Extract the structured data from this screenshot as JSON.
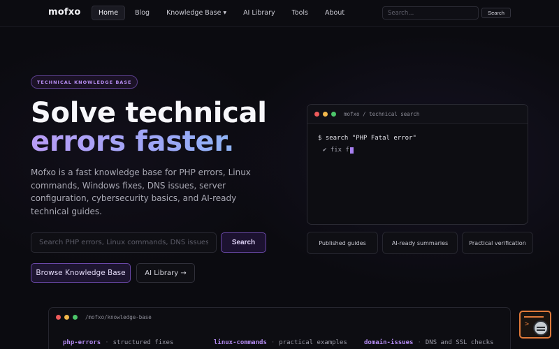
{
  "brand": {
    "logo": "mofxo"
  },
  "nav": {
    "items": [
      {
        "label": "Home",
        "active": true
      },
      {
        "label": "Blog"
      },
      {
        "label": "Knowledge Base",
        "has_dropdown": true
      },
      {
        "label": "AI Library"
      },
      {
        "label": "Tools"
      },
      {
        "label": "About"
      }
    ],
    "search_placeholder": "Search...",
    "search_button": "Search"
  },
  "hero": {
    "badge": "TECHNICAL KNOWLEDGE BASE",
    "title_line1": "Solve technical",
    "title_line2": "errors faster.",
    "description": "Mofxo is a fast knowledge base for PHP errors, Linux commands, Windows fixes, DNS issues, server configuration, cybersecurity basics, and AI-ready technical guides.",
    "search_placeholder": "Search PHP errors, Linux commands, DNS issues",
    "search_button": "Search",
    "primary_button": "Browse Knowledge Base",
    "secondary_button": "AI Library →"
  },
  "terminal": {
    "title": "mofxo / technical search",
    "line1": "$ search \"PHP Fatal error\"",
    "line2": "✔ fix f"
  },
  "features": [
    "Published guides",
    "AI-ready summaries",
    "Practical verification"
  ],
  "kb_panel": {
    "path": "/mofxo/knowledge-base",
    "rows": [
      {
        "key": "php-errors",
        "sep": "·",
        "value": "structured fixes"
      },
      {
        "key": "linux-commands",
        "sep": "·",
        "value": "practical examples"
      },
      {
        "key": "domain-issues",
        "sep": "·",
        "value": "DNS and SSL checks"
      }
    ]
  },
  "colors": {
    "background": "#0b0b10",
    "accent_purple": "#b58cf0",
    "accent_border": "#6a48a8",
    "widget_orange": "#e07a3a"
  },
  "icons": {
    "caret": "chevron-down-icon",
    "window_dots": [
      "red-dot",
      "yellow-dot",
      "green-dot"
    ],
    "widget": "terminal-search-icon"
  }
}
